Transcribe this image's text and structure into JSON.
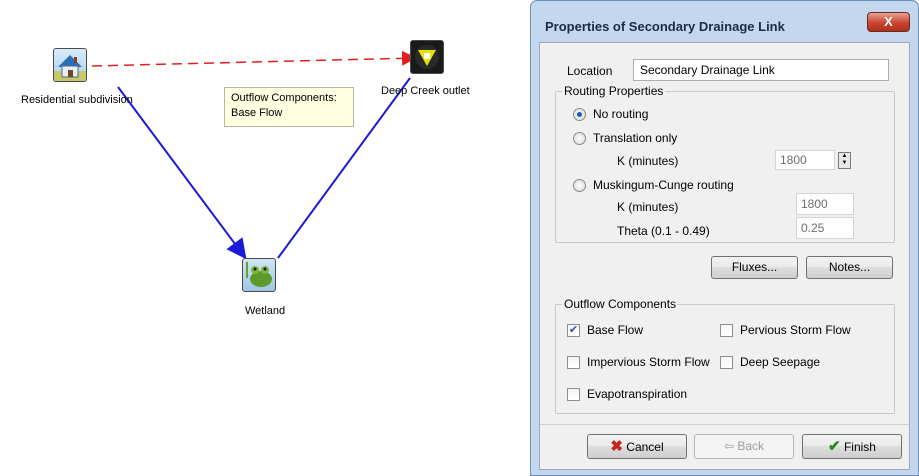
{
  "diagram": {
    "nodes": {
      "residential": {
        "label": "Residential subdivision",
        "icon": "house-icon"
      },
      "outlet": {
        "label": "Deep Creek outlet",
        "icon": "outlet-arrow-icon"
      },
      "wetland": {
        "label": "Wetland",
        "icon": "frog-icon"
      }
    },
    "tooltip": {
      "line1": "Outflow Components:",
      "line2": "Base Flow"
    },
    "colors": {
      "primary_link": "#1a1ad8",
      "secondary_link": "#e02020"
    }
  },
  "dialog": {
    "title": "Properties of Secondary Drainage Link",
    "close_label": "X",
    "location": {
      "label": "Location",
      "value": "Secondary Drainage Link"
    },
    "routing": {
      "group_label": "Routing Properties",
      "no_routing": {
        "label": "No routing",
        "selected": true
      },
      "translation_only": {
        "label": "Translation only",
        "selected": false
      },
      "translation_k": {
        "label": "K (minutes)",
        "value": "1800"
      },
      "muskingum": {
        "label": "Muskingum-Cunge routing",
        "selected": false
      },
      "muskingum_k": {
        "label": "K (minutes)",
        "value": "1800"
      },
      "theta": {
        "label": "Theta (0.1 - 0.49)",
        "value": "0.25"
      }
    },
    "buttons": {
      "fluxes": "Fluxes...",
      "notes": "Notes..."
    },
    "outflow": {
      "group_label": "Outflow Components",
      "base_flow": {
        "label": "Base Flow",
        "checked": true
      },
      "pervious": {
        "label": "Pervious Storm Flow",
        "checked": false
      },
      "impervious": {
        "label": "Impervious Storm Flow",
        "checked": false
      },
      "deep_seepage": {
        "label": "Deep Seepage",
        "checked": false
      },
      "evapo": {
        "label": "Evapotranspiration",
        "checked": false
      }
    },
    "footer": {
      "cancel": "Cancel",
      "back": "Back",
      "finish": "Finish"
    }
  }
}
